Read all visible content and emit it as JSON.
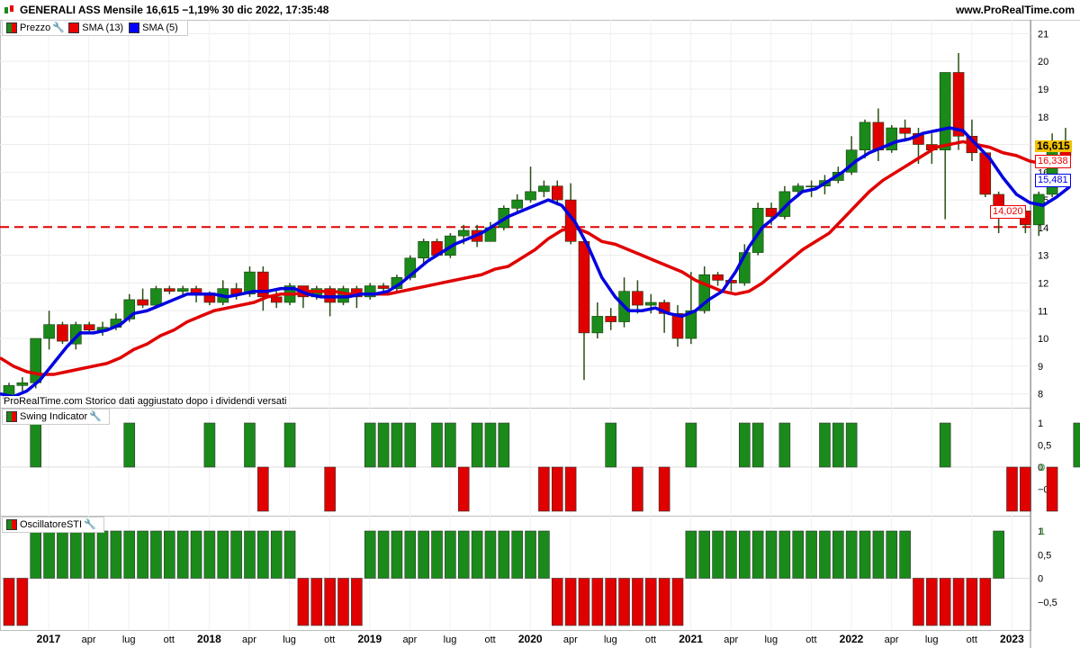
{
  "header": {
    "title": "GENERALI ASS Mensile 16,615 −1,19% 30 dic 2022, 17:35:48",
    "site": "www.ProRealTime.com"
  },
  "legend_main": [
    {
      "label": "Prezzo",
      "swatch": "split",
      "icon": "wrench-icon"
    },
    {
      "label": "SMA (13)",
      "swatch": "red"
    },
    {
      "label": "SMA (5)",
      "swatch": "blue"
    }
  ],
  "footnote": "ProRealTime.com Storico dati aggiustato dopo i dividendi versati",
  "legend_swing": {
    "label": "Swing Indicator",
    "icon": "wrench-icon"
  },
  "legend_sti": {
    "label": "OscillatoreSTI",
    "icon": "wrench-icon"
  },
  "colors": {
    "up": "#1a8a1a",
    "down": "#e00000",
    "sma13": "#e00000",
    "sma5": "#0000e0",
    "hline": "#e00000"
  },
  "price_tags": {
    "last": "16,615",
    "sma13": "16,338",
    "sma5": "15,481",
    "hline": "14,020"
  },
  "chart_data": [
    {
      "type": "candlestick",
      "yticks": [
        "8",
        "9",
        "10",
        "11",
        "12",
        "13",
        "14",
        "15",
        "16",
        "17",
        "18",
        "19",
        "20",
        "21"
      ],
      "ylim": [
        7.5,
        21.5
      ],
      "xlabels": [
        "2017",
        "apr",
        "lug",
        "ott",
        "2018",
        "apr",
        "lug",
        "ott",
        "2019",
        "apr",
        "lug",
        "ott",
        "2020",
        "apr",
        "lug",
        "ott",
        "2021",
        "apr",
        "lug",
        "ott",
        "2022",
        "apr",
        "lug",
        "ott",
        "2023"
      ],
      "horizontal_line": 14.02,
      "candles": [
        [
          7.8,
          8.3,
          7.6,
          8.4
        ],
        [
          8.3,
          8.4,
          8.1,
          8.6
        ],
        [
          8.4,
          10.0,
          8.2,
          10.0
        ],
        [
          10.0,
          10.5,
          9.6,
          11.0
        ],
        [
          10.5,
          9.9,
          9.8,
          10.6
        ],
        [
          9.8,
          10.5,
          9.6,
          10.6
        ],
        [
          10.5,
          10.3,
          10.2,
          10.6
        ],
        [
          10.3,
          10.4,
          10.1,
          10.6
        ],
        [
          10.4,
          10.7,
          10.3,
          10.9
        ],
        [
          10.7,
          11.4,
          10.6,
          11.6
        ],
        [
          11.4,
          11.2,
          11.1,
          11.8
        ],
        [
          11.2,
          11.8,
          11.1,
          11.9
        ],
        [
          11.8,
          11.7,
          11.6,
          11.9
        ],
        [
          11.7,
          11.8,
          11.5,
          11.9
        ],
        [
          11.8,
          11.6,
          11.3,
          11.9
        ],
        [
          11.6,
          11.3,
          11.2,
          11.7
        ],
        [
          11.3,
          11.8,
          11.2,
          12.1
        ],
        [
          11.8,
          11.6,
          11.4,
          12.0
        ],
        [
          11.6,
          12.4,
          11.5,
          12.6
        ],
        [
          12.4,
          11.5,
          11.0,
          12.6
        ],
        [
          11.5,
          11.3,
          11.1,
          11.7
        ],
        [
          11.3,
          11.9,
          11.2,
          12.0
        ],
        [
          11.9,
          11.5,
          11.1,
          11.9
        ],
        [
          11.5,
          11.8,
          11.4,
          11.9
        ],
        [
          11.8,
          11.3,
          10.8,
          11.9
        ],
        [
          11.3,
          11.8,
          11.2,
          11.9
        ],
        [
          11.8,
          11.5,
          11.1,
          11.9
        ],
        [
          11.5,
          11.9,
          11.4,
          12.0
        ],
        [
          11.9,
          11.8,
          11.6,
          12.0
        ],
        [
          11.8,
          12.2,
          11.7,
          12.3
        ],
        [
          12.2,
          12.9,
          12.1,
          13.0
        ],
        [
          12.9,
          13.5,
          12.7,
          13.6
        ],
        [
          13.5,
          13.0,
          13.0,
          13.6
        ],
        [
          13.0,
          13.7,
          12.9,
          13.8
        ],
        [
          13.7,
          13.9,
          13.4,
          14.1
        ],
        [
          13.9,
          13.5,
          13.3,
          14.1
        ],
        [
          13.5,
          14.0,
          13.5,
          14.2
        ],
        [
          14.0,
          14.7,
          13.9,
          14.8
        ],
        [
          14.7,
          15.0,
          14.5,
          15.2
        ],
        [
          15.0,
          15.3,
          14.9,
          16.2
        ],
        [
          15.3,
          15.5,
          15.1,
          15.7
        ],
        [
          15.5,
          15.0,
          14.8,
          15.7
        ],
        [
          15.0,
          13.5,
          13.4,
          15.6
        ],
        [
          13.5,
          10.2,
          8.5,
          13.6
        ],
        [
          10.2,
          10.8,
          10.0,
          11.3
        ],
        [
          10.8,
          10.6,
          10.3,
          11.1
        ],
        [
          10.6,
          11.7,
          10.4,
          12.2
        ],
        [
          11.7,
          11.2,
          10.9,
          12.1
        ],
        [
          11.2,
          11.3,
          10.9,
          11.6
        ],
        [
          11.3,
          10.9,
          10.2,
          11.4
        ],
        [
          10.9,
          10.0,
          9.7,
          11.2
        ],
        [
          10.0,
          11.0,
          9.8,
          12.4
        ],
        [
          11.0,
          12.3,
          10.9,
          12.6
        ],
        [
          12.3,
          12.1,
          11.9,
          12.4
        ],
        [
          12.1,
          12.0,
          11.7,
          12.2
        ],
        [
          12.0,
          13.1,
          11.9,
          13.4
        ],
        [
          13.1,
          14.7,
          13.0,
          14.9
        ],
        [
          14.7,
          14.4,
          14.1,
          14.9
        ],
        [
          14.4,
          15.3,
          14.3,
          15.5
        ],
        [
          15.3,
          15.5,
          15.1,
          15.6
        ],
        [
          15.5,
          15.5,
          15.1,
          15.7
        ],
        [
          15.5,
          15.7,
          15.2,
          15.9
        ],
        [
          15.7,
          16.0,
          15.6,
          16.2
        ],
        [
          16.0,
          16.8,
          15.9,
          17.3
        ],
        [
          16.8,
          17.8,
          16.5,
          17.9
        ],
        [
          17.8,
          16.8,
          16.4,
          18.3
        ],
        [
          16.8,
          17.6,
          16.7,
          17.7
        ],
        [
          17.6,
          17.4,
          17.1,
          17.9
        ],
        [
          17.4,
          17.0,
          16.3,
          17.6
        ],
        [
          17.0,
          16.8,
          16.3,
          17.4
        ],
        [
          16.8,
          19.6,
          14.3,
          19.6
        ],
        [
          19.6,
          17.3,
          16.8,
          20.3
        ],
        [
          17.3,
          16.7,
          16.4,
          17.9
        ],
        [
          16.7,
          15.2,
          15.1,
          16.7
        ],
        [
          15.2,
          14.7,
          13.8,
          15.3
        ],
        [
          14.7,
          14.6,
          14.4,
          14.8
        ],
        [
          14.6,
          14.1,
          13.8,
          14.7
        ],
        [
          14.1,
          15.2,
          13.7,
          15.3
        ],
        [
          15.2,
          16.9,
          15.1,
          17.4
        ],
        [
          16.9,
          16.6,
          16.3,
          17.6
        ]
      ],
      "sma13": [
        9.3,
        9.0,
        8.8,
        8.7,
        8.7,
        8.8,
        8.9,
        9.0,
        9.1,
        9.3,
        9.6,
        9.8,
        10.1,
        10.3,
        10.6,
        10.8,
        11.0,
        11.1,
        11.2,
        11.3,
        11.5,
        11.6,
        11.6,
        11.7,
        11.7,
        11.7,
        11.6,
        11.6,
        11.6,
        11.6,
        11.7,
        11.8,
        11.9,
        12.0,
        12.1,
        12.2,
        12.3,
        12.5,
        12.6,
        12.9,
        13.2,
        13.6,
        13.9,
        14.0,
        13.8,
        13.5,
        13.4,
        13.2,
        13.0,
        12.8,
        12.6,
        12.4,
        12.1,
        11.9,
        11.7,
        11.6,
        11.7,
        12.0,
        12.4,
        12.8,
        13.2,
        13.5,
        13.8,
        14.3,
        14.8,
        15.3,
        15.7,
        16.0,
        16.3,
        16.6,
        16.9,
        17.0,
        17.1,
        17.0,
        16.9,
        16.7,
        16.6,
        16.4,
        16.3,
        16.3,
        16.34
      ],
      "sma5": [
        8.0,
        7.9,
        8.1,
        8.5,
        9.1,
        9.7,
        10.2,
        10.2,
        10.3,
        10.5,
        10.9,
        11.0,
        11.2,
        11.4,
        11.6,
        11.6,
        11.6,
        11.5,
        11.6,
        11.7,
        11.7,
        11.8,
        11.8,
        11.6,
        11.5,
        11.5,
        11.5,
        11.6,
        11.6,
        11.7,
        12.0,
        12.4,
        12.8,
        13.1,
        13.4,
        13.6,
        13.8,
        14.1,
        14.4,
        14.6,
        14.8,
        15.0,
        14.8,
        14.2,
        13.3,
        12.2,
        11.5,
        11.0,
        11.0,
        11.1,
        10.9,
        10.8,
        11.0,
        11.4,
        11.7,
        12.4,
        13.3,
        14.0,
        14.4,
        14.9,
        15.3,
        15.4,
        15.7,
        16.0,
        16.4,
        16.7,
        16.9,
        17.1,
        17.2,
        17.4,
        17.5,
        17.6,
        17.5,
        17.0,
        16.5,
        15.8,
        15.2,
        14.9,
        14.8,
        15.1,
        15.48
      ]
    },
    {
      "type": "bar",
      "name": "Swing Indicator",
      "yticks": [
        "1",
        "0,5",
        "0",
        "−0,5"
      ],
      "ylim": [
        -1,
        1
      ],
      "current_value": "0",
      "values": [
        0,
        0,
        1,
        0,
        0,
        0,
        0,
        0,
        0,
        1,
        0,
        0,
        0,
        0,
        0,
        1,
        0,
        0,
        1,
        -1,
        0,
        1,
        0,
        0,
        -1,
        0,
        0,
        1,
        1,
        1,
        1,
        0,
        1,
        1,
        -1,
        1,
        1,
        1,
        0,
        0,
        -1,
        -1,
        -1,
        0,
        0,
        1,
        0,
        -1,
        0,
        -1,
        0,
        1,
        0,
        0,
        0,
        1,
        1,
        0,
        1,
        0,
        0,
        1,
        1,
        1,
        0,
        0,
        0,
        0,
        0,
        0,
        1,
        0,
        0,
        0,
        0,
        -1,
        -1,
        0,
        -1,
        0,
        1
      ]
    },
    {
      "type": "bar",
      "name": "OscillatoreSTI",
      "yticks": [
        "1",
        "0,5",
        "0",
        "−0,5"
      ],
      "ylim": [
        -1,
        1
      ],
      "current_value": "1",
      "values": [
        -1,
        -1,
        1,
        1,
        1,
        1,
        1,
        1,
        1,
        1,
        1,
        1,
        1,
        1,
        1,
        1,
        1,
        1,
        1,
        1,
        1,
        1,
        -1,
        -1,
        -1,
        -1,
        -1,
        1,
        1,
        1,
        1,
        1,
        1,
        1,
        1,
        1,
        1,
        1,
        1,
        1,
        1,
        -1,
        -1,
        -1,
        -1,
        -1,
        -1,
        -1,
        -1,
        -1,
        -1,
        1,
        1,
        1,
        1,
        1,
        1,
        1,
        1,
        1,
        1,
        1,
        1,
        1,
        1,
        1,
        1,
        1,
        -1,
        -1,
        -1,
        -1,
        -1,
        -1,
        1
      ]
    }
  ]
}
